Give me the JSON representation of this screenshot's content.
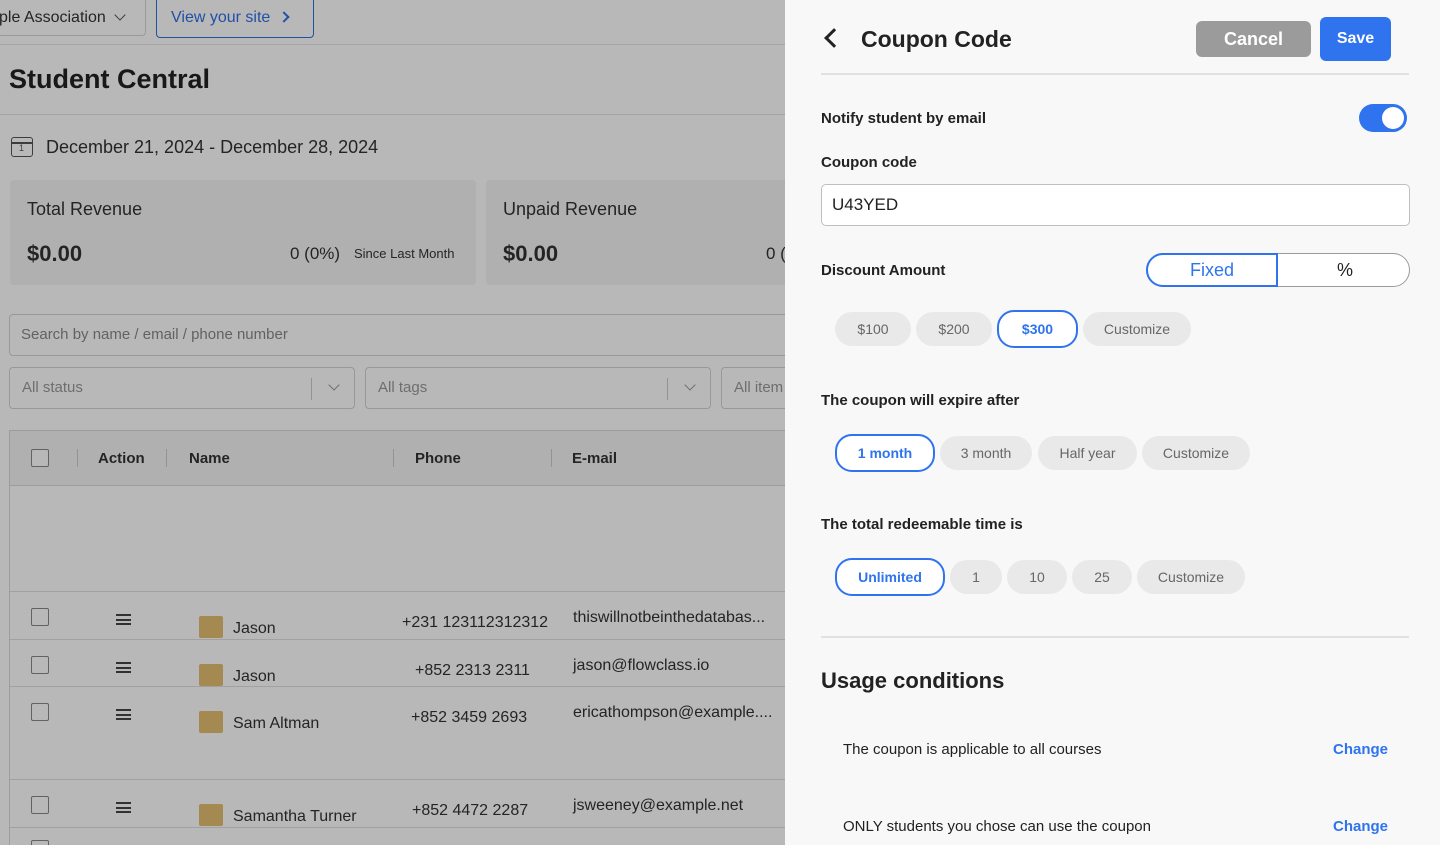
{
  "background": {
    "org_name": "ple Association",
    "view_site_label": "View your site",
    "page_title": "Student Central",
    "date_range": "December 21, 2024 - December 28, 2024",
    "cards": [
      {
        "label": "Total Revenue",
        "value": "$0.00",
        "change": "0 (0%)",
        "since": "Since Last Month"
      },
      {
        "label": "Unpaid Revenue",
        "value": "$0.00",
        "change": "0 ("
      }
    ],
    "search_placeholder": "Search by name / email / phone number",
    "filters": [
      "All status",
      "All tags",
      "All item"
    ],
    "table": {
      "headers": [
        "Action",
        "Name",
        "Phone",
        "E-mail"
      ],
      "rows": [
        {
          "name": "Jason",
          "phone": "+231 123112312312",
          "email": "thiswillnotbeinthedatabas..."
        },
        {
          "name": "Jason",
          "phone": "+852 2313 2311",
          "email": "jason@flowclass.io"
        },
        {
          "name": "Sam Altman",
          "phone": "+852 3459 2693",
          "email": "ericathompson@example...."
        },
        {
          "name": "Samantha Turner",
          "phone": "+852 4472 2287",
          "email": "jsweeney@example.net"
        }
      ]
    }
  },
  "drawer": {
    "title": "Coupon Code",
    "cancel_label": "Cancel",
    "save_label": "Save",
    "notify_label": "Notify student by email",
    "notify_on": true,
    "coupon_code_label": "Coupon code",
    "coupon_code_value": "U43YED",
    "discount_label": "Discount Amount",
    "discount_modes": [
      "Fixed",
      "%"
    ],
    "discount_mode_selected": "Fixed",
    "discount_options": [
      "$100",
      "$200",
      "$300",
      "Customize"
    ],
    "discount_selected": "$300",
    "expire_label": "The coupon will expire after",
    "expire_options": [
      "1 month",
      "3 month",
      "Half year",
      "Customize"
    ],
    "expire_selected": "1 month",
    "redeem_label": "The total redeemable time is",
    "redeem_options": [
      "Unlimited",
      "1",
      "10",
      "25",
      "Customize"
    ],
    "redeem_selected": "Unlimited",
    "usage_title": "Usage conditions",
    "conditions": [
      {
        "text": "The coupon is applicable to all courses",
        "action": "Change"
      },
      {
        "text": "ONLY students you chose can use the coupon",
        "action": "Change"
      }
    ]
  },
  "colors": {
    "accent": "#2f74ee",
    "cancel_bg": "#9b9b9b",
    "drawer_bg": "#f8f8f8"
  }
}
